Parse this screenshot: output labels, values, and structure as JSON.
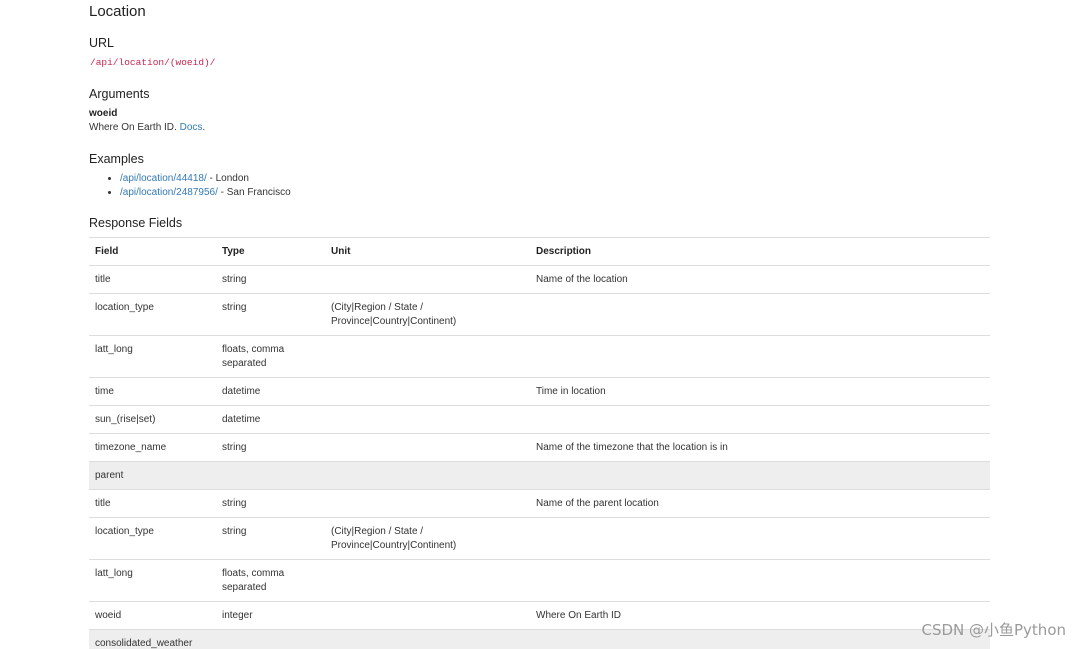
{
  "section": {
    "title": "Location"
  },
  "url": {
    "heading": "URL",
    "path": "/api/location/(woeid)/"
  },
  "arguments": {
    "heading": "Arguments",
    "name": "woeid",
    "description": "Where On Earth ID.",
    "docs_link": "Docs",
    "suffix": "."
  },
  "examples": {
    "heading": "Examples",
    "items": [
      {
        "link": "/api/location/44418/",
        "label": " - London"
      },
      {
        "link": "/api/location/2487956/",
        "label": " - San Francisco"
      }
    ]
  },
  "response": {
    "heading": "Response Fields",
    "columns": [
      "Field",
      "Type",
      "Unit",
      "Description"
    ],
    "rows": [
      {
        "field": "title",
        "type": "string",
        "unit": "",
        "description": "Name of the location"
      },
      {
        "field": "location_type",
        "type": "string",
        "unit": "(City|Region / State / Province|Country|Continent)",
        "description": ""
      },
      {
        "field": "latt_long",
        "type": "floats, comma separated",
        "unit": "",
        "description": ""
      },
      {
        "field": "time",
        "type": "datetime",
        "unit": "",
        "description": "Time in location"
      },
      {
        "field": "sun_(rise|set)",
        "type": "datetime",
        "unit": "",
        "description": ""
      },
      {
        "field": "timezone_name",
        "type": "string",
        "unit": "",
        "description": "Name of the timezone that the location is in"
      },
      {
        "group": "parent"
      },
      {
        "field": "title",
        "type": "string",
        "unit": "",
        "description": "Name of the parent location"
      },
      {
        "field": "location_type",
        "type": "string",
        "unit": "(City|Region / State / Province|Country|Continent)",
        "description": ""
      },
      {
        "field": "latt_long",
        "type": "floats, comma separated",
        "unit": "",
        "description": ""
      },
      {
        "field": "woeid",
        "type": "integer",
        "unit": "",
        "description": "Where On Earth ID"
      },
      {
        "group": "consolidated_weather"
      }
    ]
  },
  "watermark": "CSDN @小鱼Python"
}
